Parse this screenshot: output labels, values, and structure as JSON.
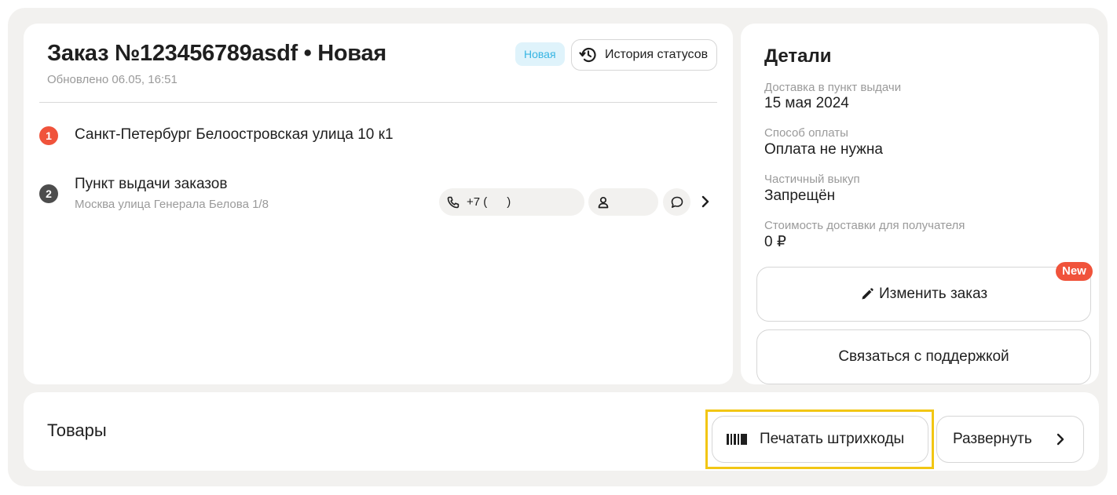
{
  "order": {
    "title": "Заказ №123456789asdf • Новая",
    "updated": "Обновлено 06.05, 16:51",
    "status_badge": "Новая",
    "history_button": "История статусов"
  },
  "route": [
    {
      "number": "1",
      "title": "Санкт-Петербург Белоостровская улица 10 к1",
      "color": "#f0533b"
    },
    {
      "number": "2",
      "title": "Пункт выдачи заказов",
      "subtitle": "Москва улица Генерала Белова 1/8",
      "color": "#4d4d4d",
      "phone": "+7 (      )"
    }
  ],
  "details": {
    "title": "Детали",
    "fields": [
      {
        "label": "Доставка в пункт выдачи",
        "value": "15 мая 2024"
      },
      {
        "label": "Способ оплаты",
        "value": "Оплата не нужна"
      },
      {
        "label": "Частичный выкуп",
        "value": "Запрещён"
      },
      {
        "label": "Стоимость доставки для получателя",
        "value": "0 ₽"
      }
    ],
    "edit_button": "Изменить заказ",
    "edit_badge": "New",
    "support_button": "Связаться с поддержкой"
  },
  "goods": {
    "title": "Товары",
    "print_button": "Печатать штрихкоды",
    "expand_button": "Развернуть"
  },
  "colors": {
    "background": "#f2f1ef",
    "accent_red": "#f0533b",
    "badge_blue_bg": "#dff3fb",
    "badge_blue_text": "#37b5e3",
    "highlight_yellow": "#f2c614"
  }
}
